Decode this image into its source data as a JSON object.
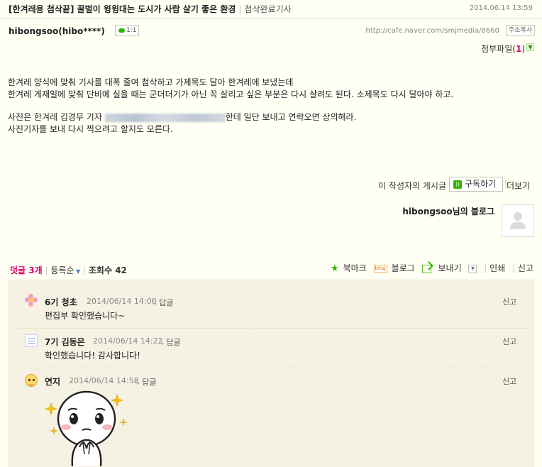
{
  "post": {
    "title": "[한겨레용 첨삭끝] 꿀벌이 윙윙대는 도시가 사람 살기 좋은 환경",
    "board": "첨삭완료기사",
    "date": "2014.06.14 13:59",
    "author": "hibongsoo(hibo****)",
    "chat_badge": "1:1",
    "url": "http://cafe.naver.com/smjmedia/8660",
    "copy_label": "주소복사",
    "attach_label": "첨부파일",
    "attach_count": "1",
    "body": [
      "한겨레 양식에 맞춰 기사를 대폭 줄여 첨삭하고 가제목도 달아 한겨레에 보냈는데",
      "한겨레 게재일에 맞춰 단비에 실을 때는 군더더기가 아닌 꼭 살리고 싶은 부분은 다시 살려도 된다. 소제목도 다시 달아야 하고.",
      "사진은 한겨레 김경무 기자",
      "한테 일단 보내고 연락오면 상의해라.",
      "사진기자를 보내 다시 찍으려고 할지도 모른다."
    ]
  },
  "author_posts": {
    "other_posts": "이 작성자의 게시글",
    "subscribe": "구독하기",
    "more": "더보기",
    "blog_name": "hibongsoo님의 블로그"
  },
  "comment_bar": {
    "count_label": "덧글 3개",
    "order": "등록순",
    "views": "조회수 42",
    "bookmark": "북마크",
    "blog_tag": "blog",
    "blog": "블로그",
    "send": "보내기",
    "print": "인쇄",
    "report": "신고"
  },
  "comments": [
    {
      "name": "6기 청초",
      "date": "2014/06/14 14:00",
      "reply": "답글",
      "text": "편집부 확인했습니다~",
      "report": "신고",
      "icon": "flower-icon"
    },
    {
      "name": "7기 김동은",
      "date": "2014/06/14 14:22",
      "reply": "답글",
      "text": "확인했습니다! 감사합니다!",
      "report": "신고",
      "icon": "note-icon"
    },
    {
      "name": "연지",
      "date": "2014/06/14 14:58",
      "reply": "답글",
      "text": "",
      "report": "신고",
      "icon": "face-icon"
    }
  ],
  "colors": {
    "accent_pink": "#d4006b",
    "naver_green": "#2db400",
    "page_bg": "#fffff4",
    "comment_bg": "#f5f2e4"
  }
}
